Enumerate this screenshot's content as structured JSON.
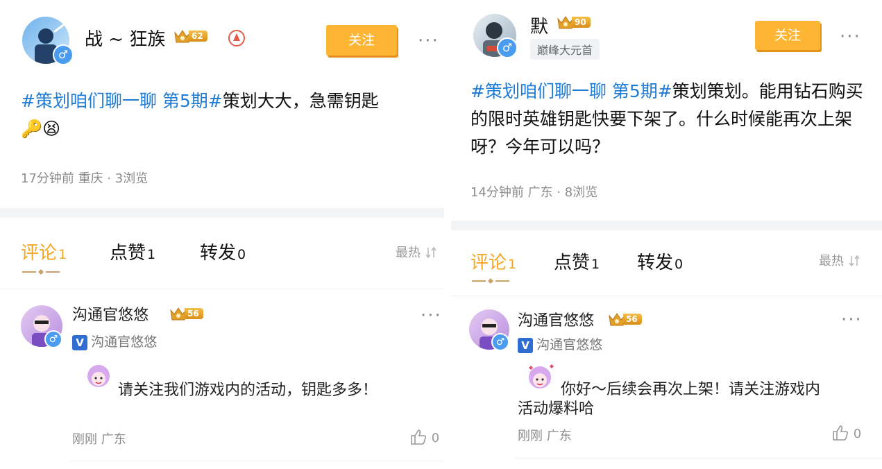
{
  "colors": {
    "accent": "#f5a623",
    "tag": "#1f7bd4",
    "follow": "#ffb534",
    "gender": "#4a9cf0"
  },
  "left": {
    "author": {
      "name": "战 ~ 狂族",
      "level": "62",
      "gender_icon": "♂"
    },
    "follow_label": "关注",
    "more_label": "···",
    "post": {
      "tag": "#策划咱们聊一聊 第5期#",
      "text": "策划大大，急需钥匙",
      "emojis": "🔑😫"
    },
    "meta": "17分钟前 重庆 · 3浏览",
    "tabs": [
      {
        "label": "评论",
        "count": "1"
      },
      {
        "label": "点赞",
        "count": "1"
      },
      {
        "label": "转发",
        "count": "0"
      }
    ],
    "sort_label": "最热",
    "comment": {
      "name": "沟通官悠悠",
      "level": "56",
      "verified": "沟通官悠悠",
      "v_badge": "V",
      "text": "请关注我们游戏内的活动，钥匙多多！",
      "meta": "刚刚  广东",
      "likes": "0",
      "more": "···"
    }
  },
  "right": {
    "author": {
      "name": "默",
      "level": "90",
      "title_badge": "巅峰大元首",
      "gender_icon": "♂"
    },
    "follow_label": "关注",
    "more_label": "···",
    "post": {
      "tag": "#策划咱们聊一聊 第5期#",
      "text": "策划策划。能用钻石购买的限时英雄钥匙快要下架了。什么时候能再次上架呀？今年可以吗？"
    },
    "meta": "14分钟前 广东 · 8浏览",
    "tabs": [
      {
        "label": "评论",
        "count": "1"
      },
      {
        "label": "点赞",
        "count": "1"
      },
      {
        "label": "转发",
        "count": "0"
      }
    ],
    "sort_label": "最热",
    "comment": {
      "name": "沟通官悠悠",
      "level": "56",
      "verified": "沟通官悠悠",
      "v_badge": "V",
      "text": "你好～后续会再次上架！请关注游戏内活动爆料哈",
      "meta": "刚刚  广东",
      "likes": "0",
      "more": "···"
    }
  }
}
